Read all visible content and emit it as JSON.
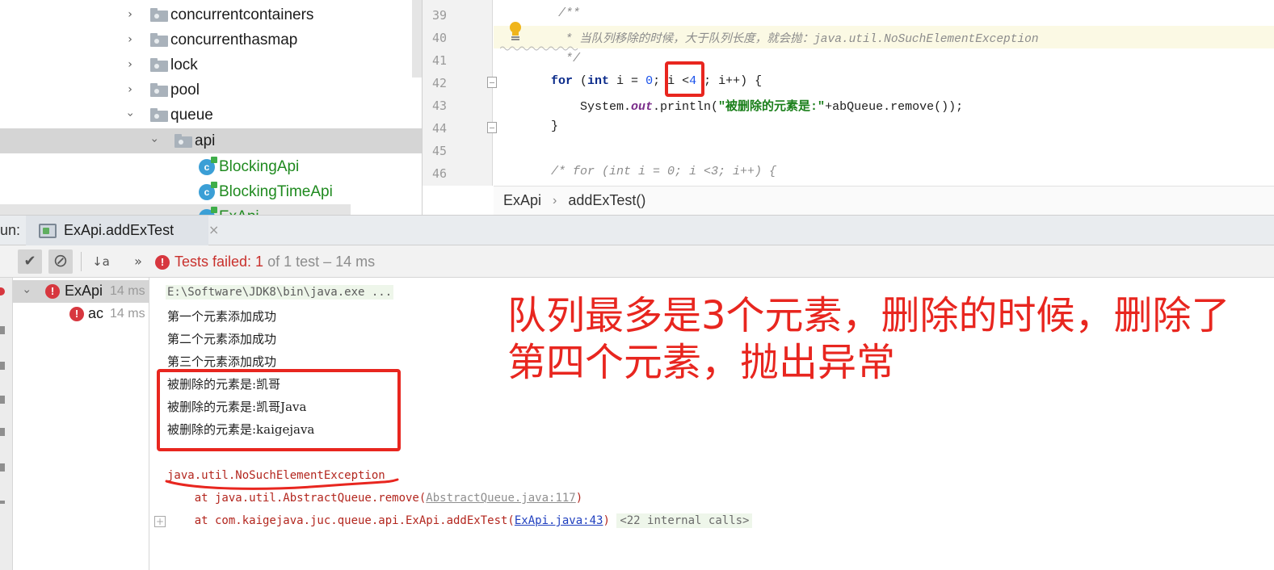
{
  "project_tree": {
    "items": [
      {
        "label": "concurrentcontainers"
      },
      {
        "label": "concurrenthasmap"
      },
      {
        "label": "lock"
      },
      {
        "label": "pool"
      },
      {
        "label": "queue"
      },
      {
        "label": "api"
      },
      {
        "label": "BlockingApi"
      },
      {
        "label": "BlockingTimeApi"
      },
      {
        "label": "ExApi"
      }
    ]
  },
  "editor": {
    "line_numbers": [
      "39",
      "40",
      "41",
      "42",
      "43",
      "44",
      "45",
      "46"
    ],
    "code": {
      "l39": "/**",
      "l40": " * 当队列移除的时候，大于队列长度，就会抛：java.util.NoSuchElementException",
      "l41": " */",
      "l42_kw_for": "for",
      "l42_a": " (",
      "l42_kw_int": "int",
      "l42_b": " i = ",
      "l42_zero": "0",
      "l42_c": "; i <",
      "l42_four": "4",
      "l42_d": " ; i++) {",
      "l43_a": "System.",
      "l43_out": "out",
      "l43_b": ".println(",
      "l43_str": "\"被删除的元素是:\"",
      "l43_c": "+abQueue.remove());",
      "l44": "}",
      "l45": "",
      "l46": "/* for (int i = 0; i <3; i++) {"
    },
    "breadcrumb": {
      "class_name": "ExApi",
      "separator": "›",
      "method_name": "addExTest()"
    }
  },
  "run": {
    "label": "un:",
    "tab_label": "ExApi.addExTest",
    "tab_close": "×",
    "toolbar": {
      "check_icon": "✔",
      "stop_icon": "⊘",
      "sort_icon": "↓a",
      "more_icon": "»"
    },
    "status": {
      "prefix": "Tests failed: ",
      "count": "1",
      "suffix": " of 1 test – 14 ms"
    },
    "test_tree": [
      {
        "name": "ExApi",
        "time": "14 ms"
      },
      {
        "name": "ac",
        "time": "14 ms"
      }
    ]
  },
  "console": {
    "command": "E:\\Software\\JDK8\\bin\\java.exe ...",
    "lines": [
      "第一个元素添加成功",
      "第二个元素添加成功",
      "第三个元素添加成功",
      "被删除的元素是:凯哥",
      "被删除的元素是:凯哥Java",
      "被删除的元素是:kaigejava"
    ],
    "exception": "java.util.NoSuchElementException",
    "trace1_prefix": "    at java.util.AbstractQueue.remove(",
    "trace1_link": "AbstractQueue.java:117",
    "trace1_suffix": ")",
    "trace2_prefix": "    at com.kaigejava.juc.queue.api.ExApi.addExTest(",
    "trace2_link": "ExApi.java:43",
    "trace2_suffix": ")",
    "trace2_internal": "<22 internal calls>"
  },
  "annotation": {
    "line1": "队列最多是3个元素，删除的时候，删除了",
    "line2": "第四个元素，抛出异常"
  },
  "colors": {
    "annotation_red": "#e8261f",
    "error_red": "#d7373f",
    "selection_gray": "#d5d5d5"
  }
}
